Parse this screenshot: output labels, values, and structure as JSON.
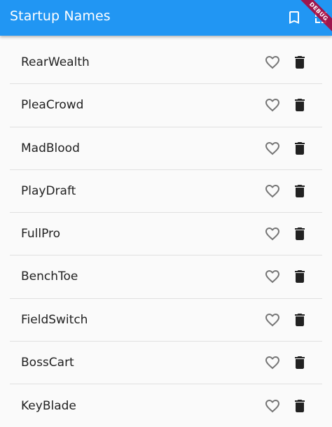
{
  "appbar": {
    "title": "Startup Names",
    "saved_icon": "bookmark-icon",
    "second_icon": "expand-icon",
    "color": "#2196f3"
  },
  "debug_banner": {
    "label": "DEBUG"
  },
  "list": {
    "items": [
      {
        "name": "RearWealth"
      },
      {
        "name": "PleaCrowd"
      },
      {
        "name": "MadBlood"
      },
      {
        "name": "PlayDraft"
      },
      {
        "name": "FullPro"
      },
      {
        "name": "BenchToe"
      },
      {
        "name": "FieldSwitch"
      },
      {
        "name": "BossCart"
      },
      {
        "name": "KeyBlade"
      }
    ],
    "favorite_icon": "heart-outline-icon",
    "delete_icon": "trash-icon"
  }
}
